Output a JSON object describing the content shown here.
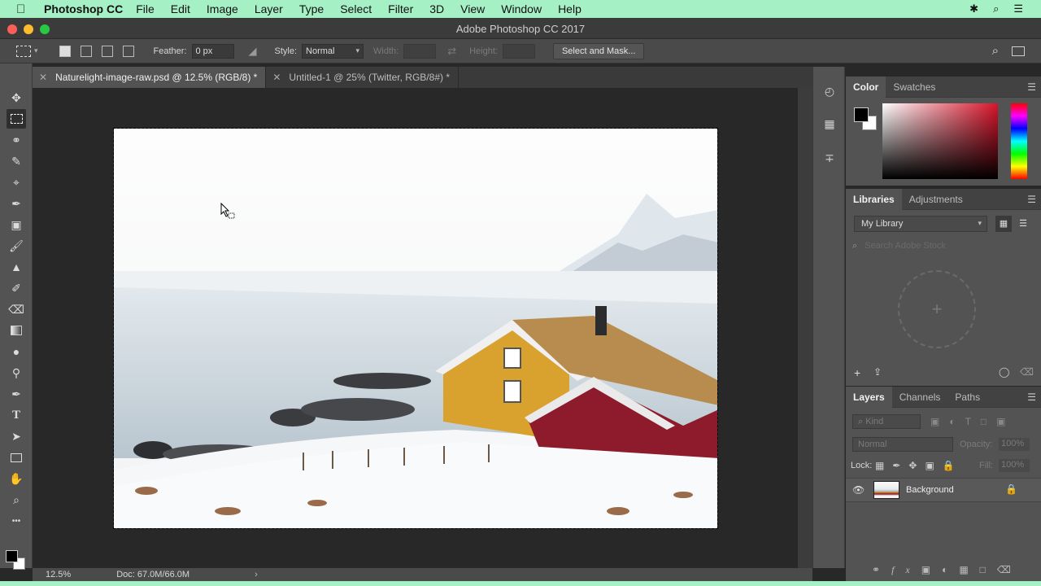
{
  "menubar": {
    "app_name": "Photoshop CC",
    "items": [
      "File",
      "Edit",
      "Image",
      "Layer",
      "Type",
      "Select",
      "Filter",
      "3D",
      "View",
      "Window",
      "Help"
    ],
    "icons": [
      "apple-icon",
      "bluetooth-icon",
      "search-icon",
      "menu-icon"
    ],
    "background": "#a6f0c6"
  },
  "window": {
    "title": "Adobe Photoshop CC 2017"
  },
  "options": {
    "feather_label": "Feather:",
    "feather_value": "0 px",
    "style_label": "Style:",
    "style_value": "Normal",
    "width_label": "Width:",
    "height_label": "Height:",
    "select_mask_label": "Select and Mask..."
  },
  "tabs": [
    {
      "label": "Naturelight-image-raw.psd @ 12.5% (RGB/8) *",
      "active": true
    },
    {
      "label": "Untitled-1 @ 25% (Twitter, RGB/8#) *",
      "active": false
    }
  ],
  "status": {
    "zoom": "12.5%",
    "doc": "Doc: 67.0M/66.0M"
  },
  "color_panel": {
    "tabs": [
      "Color",
      "Swatches"
    ],
    "foreground": "#000000",
    "background": "#ffffff",
    "hue_color": "#d8142a"
  },
  "libraries_panel": {
    "tabs": [
      "Libraries",
      "Adjustments"
    ],
    "library_name": "My Library",
    "search_placeholder": "Search Adobe Stock"
  },
  "layers_panel": {
    "tabs": [
      "Layers",
      "Channels",
      "Paths"
    ],
    "kind_placeholder": "Kind",
    "blend_mode": "Normal",
    "opacity_label": "Opacity:",
    "opacity_value": "100%",
    "lock_label": "Lock:",
    "fill_label": "Fill:",
    "fill_value": "100%",
    "layers": [
      {
        "name": "Background",
        "visible": true,
        "locked": true
      }
    ]
  }
}
